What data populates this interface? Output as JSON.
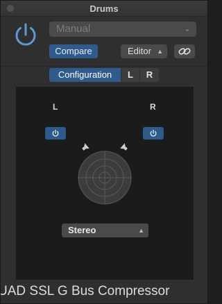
{
  "window": {
    "title": "Drums"
  },
  "header": {
    "preset": "Manual",
    "compare_label": "Compare",
    "editor_label": "Editor"
  },
  "view_selector": {
    "items": [
      "Configuration",
      "L",
      "R"
    ],
    "selected": "Configuration"
  },
  "panel": {
    "left_label": "L",
    "right_label": "R",
    "mode": "Stereo"
  },
  "footer": {
    "plugin_name": "UAD SSL G Bus Compressor"
  },
  "colors": {
    "accent": "#2e5a8c",
    "power_icon": "#5b9bd5"
  }
}
